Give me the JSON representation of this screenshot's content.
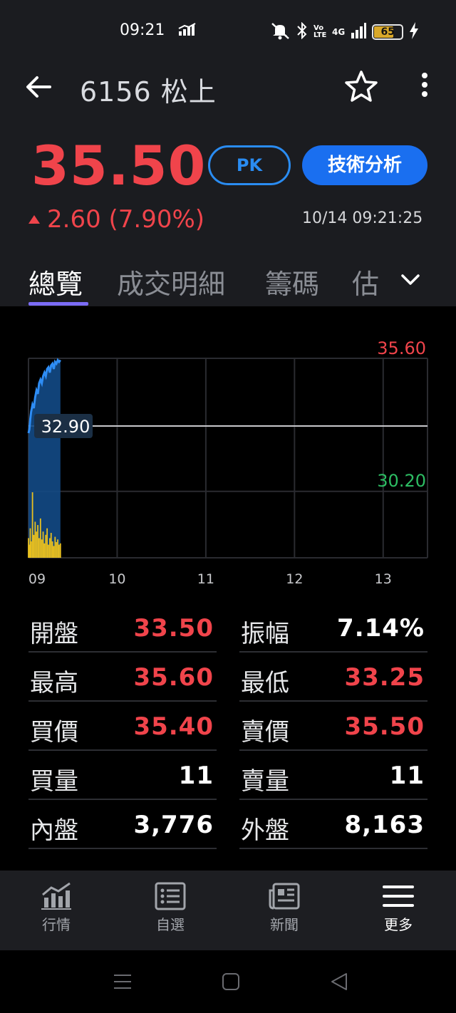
{
  "status_bar": {
    "time": "09:21",
    "volte": "Vo LTE",
    "network": "4G",
    "battery": "65"
  },
  "header": {
    "title": "6156 松上"
  },
  "quote": {
    "price": "35.50",
    "change": "2.60 (7.90%)",
    "datetime": "10/14 09:21:25",
    "pk_label": "PK",
    "ta_label": "技術分析"
  },
  "tabs": [
    {
      "label": "總覽",
      "active": true
    },
    {
      "label": "成交明細",
      "active": false
    },
    {
      "label": "籌碼",
      "active": false
    },
    {
      "label": "估",
      "active": false
    }
  ],
  "chart_data": {
    "type": "line",
    "x_ticks": [
      "09",
      "10",
      "11",
      "12",
      "13"
    ],
    "y_high_label": "35.60",
    "y_ref_label": "32.90",
    "y_low_label": "30.20",
    "ylim": [
      30.2,
      35.6
    ],
    "reference": 32.9,
    "x_hours": [
      9.0,
      9.01,
      9.02,
      9.03,
      9.045,
      9.06,
      9.075,
      9.09,
      9.105,
      9.12,
      9.135,
      9.15,
      9.165,
      9.18,
      9.195,
      9.21,
      9.225,
      9.24,
      9.255,
      9.27,
      9.285,
      9.3,
      9.315,
      9.33,
      9.345,
      9.36
    ],
    "price_series": [
      33.5,
      33.6,
      33.9,
      34.1,
      34.3,
      34.2,
      34.5,
      34.7,
      34.6,
      34.9,
      35.0,
      34.9,
      35.1,
      35.2,
      35.1,
      35.3,
      35.35,
      35.2,
      35.4,
      35.45,
      35.3,
      35.5,
      35.45,
      35.55,
      35.5,
      35.55
    ],
    "volume_series": [
      30,
      20,
      45,
      25,
      100,
      35,
      55,
      40,
      50,
      30,
      60,
      28,
      40,
      22,
      35,
      45,
      20,
      30,
      38,
      25,
      18,
      32,
      24,
      28,
      20,
      22
    ],
    "colors": {
      "high": "#f0444b",
      "low": "#2dbd63",
      "line": "#2e8df5",
      "area": "#134a86",
      "volume": "#e9c01f",
      "ref": "#c8c8cc",
      "grid": "#2a2b30"
    }
  },
  "stats": {
    "left": [
      {
        "label": "開盤",
        "value": "33.50",
        "color": "#f0444b"
      },
      {
        "label": "最高",
        "value": "35.60",
        "color": "#f0444b"
      },
      {
        "label": "買價",
        "value": "35.40",
        "color": "#f0444b"
      },
      {
        "label": "買量",
        "value": "11",
        "color": "#ffffff"
      },
      {
        "label": "內盤",
        "value": "3,776",
        "color": "#ffffff"
      }
    ],
    "right": [
      {
        "label": "振幅",
        "value": "7.14%",
        "color": "#ffffff"
      },
      {
        "label": "最低",
        "value": "33.25",
        "color": "#f0444b"
      },
      {
        "label": "賣價",
        "value": "35.50",
        "color": "#f0444b"
      },
      {
        "label": "賣量",
        "value": "11",
        "color": "#ffffff"
      },
      {
        "label": "外盤",
        "value": "8,163",
        "color": "#ffffff"
      }
    ]
  },
  "bottom_nav": [
    {
      "label": "行情",
      "icon": "chart-icon",
      "active": false
    },
    {
      "label": "自選",
      "icon": "list-icon",
      "active": false
    },
    {
      "label": "新聞",
      "icon": "news-icon",
      "active": false
    },
    {
      "label": "更多",
      "icon": "menu-icon",
      "active": true
    }
  ]
}
